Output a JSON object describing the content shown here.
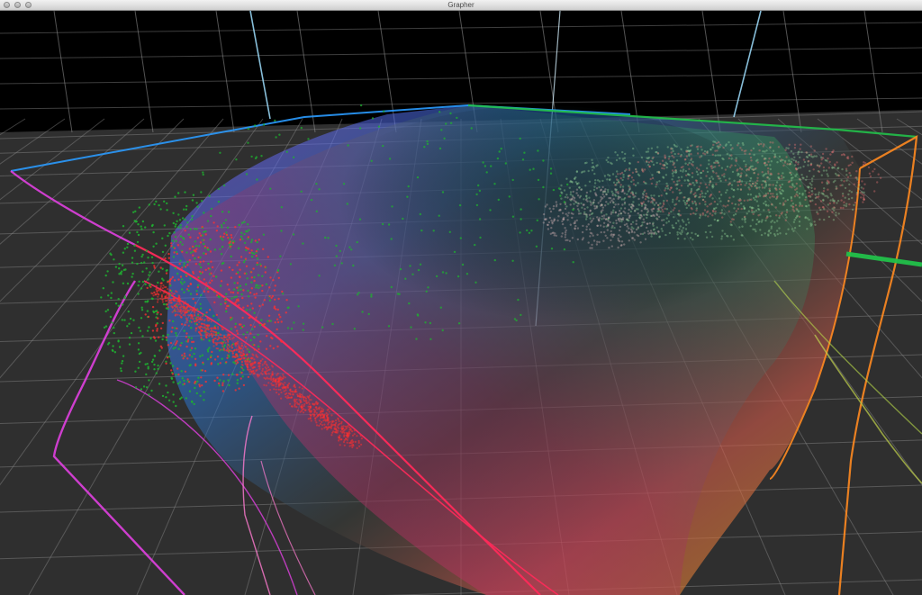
{
  "window": {
    "title": "Grapher"
  },
  "icons": {
    "close": "close-button-icon",
    "minimize": "minimize-button-icon",
    "zoom": "zoom-button-icon"
  },
  "colors": {
    "background_wall": "#000000",
    "floor": "#2f2f2f",
    "grid": "#8a8a8a",
    "axis": "#9fe0ff",
    "gamut_blue": "#2a9bff",
    "gamut_green": "#22c14a",
    "gamut_red": "#ff2a5a",
    "gamut_magenta": "#e040e0",
    "gamut_orange": "#ff8a20",
    "points_green": "#1fb030",
    "points_red": "#ff3030"
  }
}
